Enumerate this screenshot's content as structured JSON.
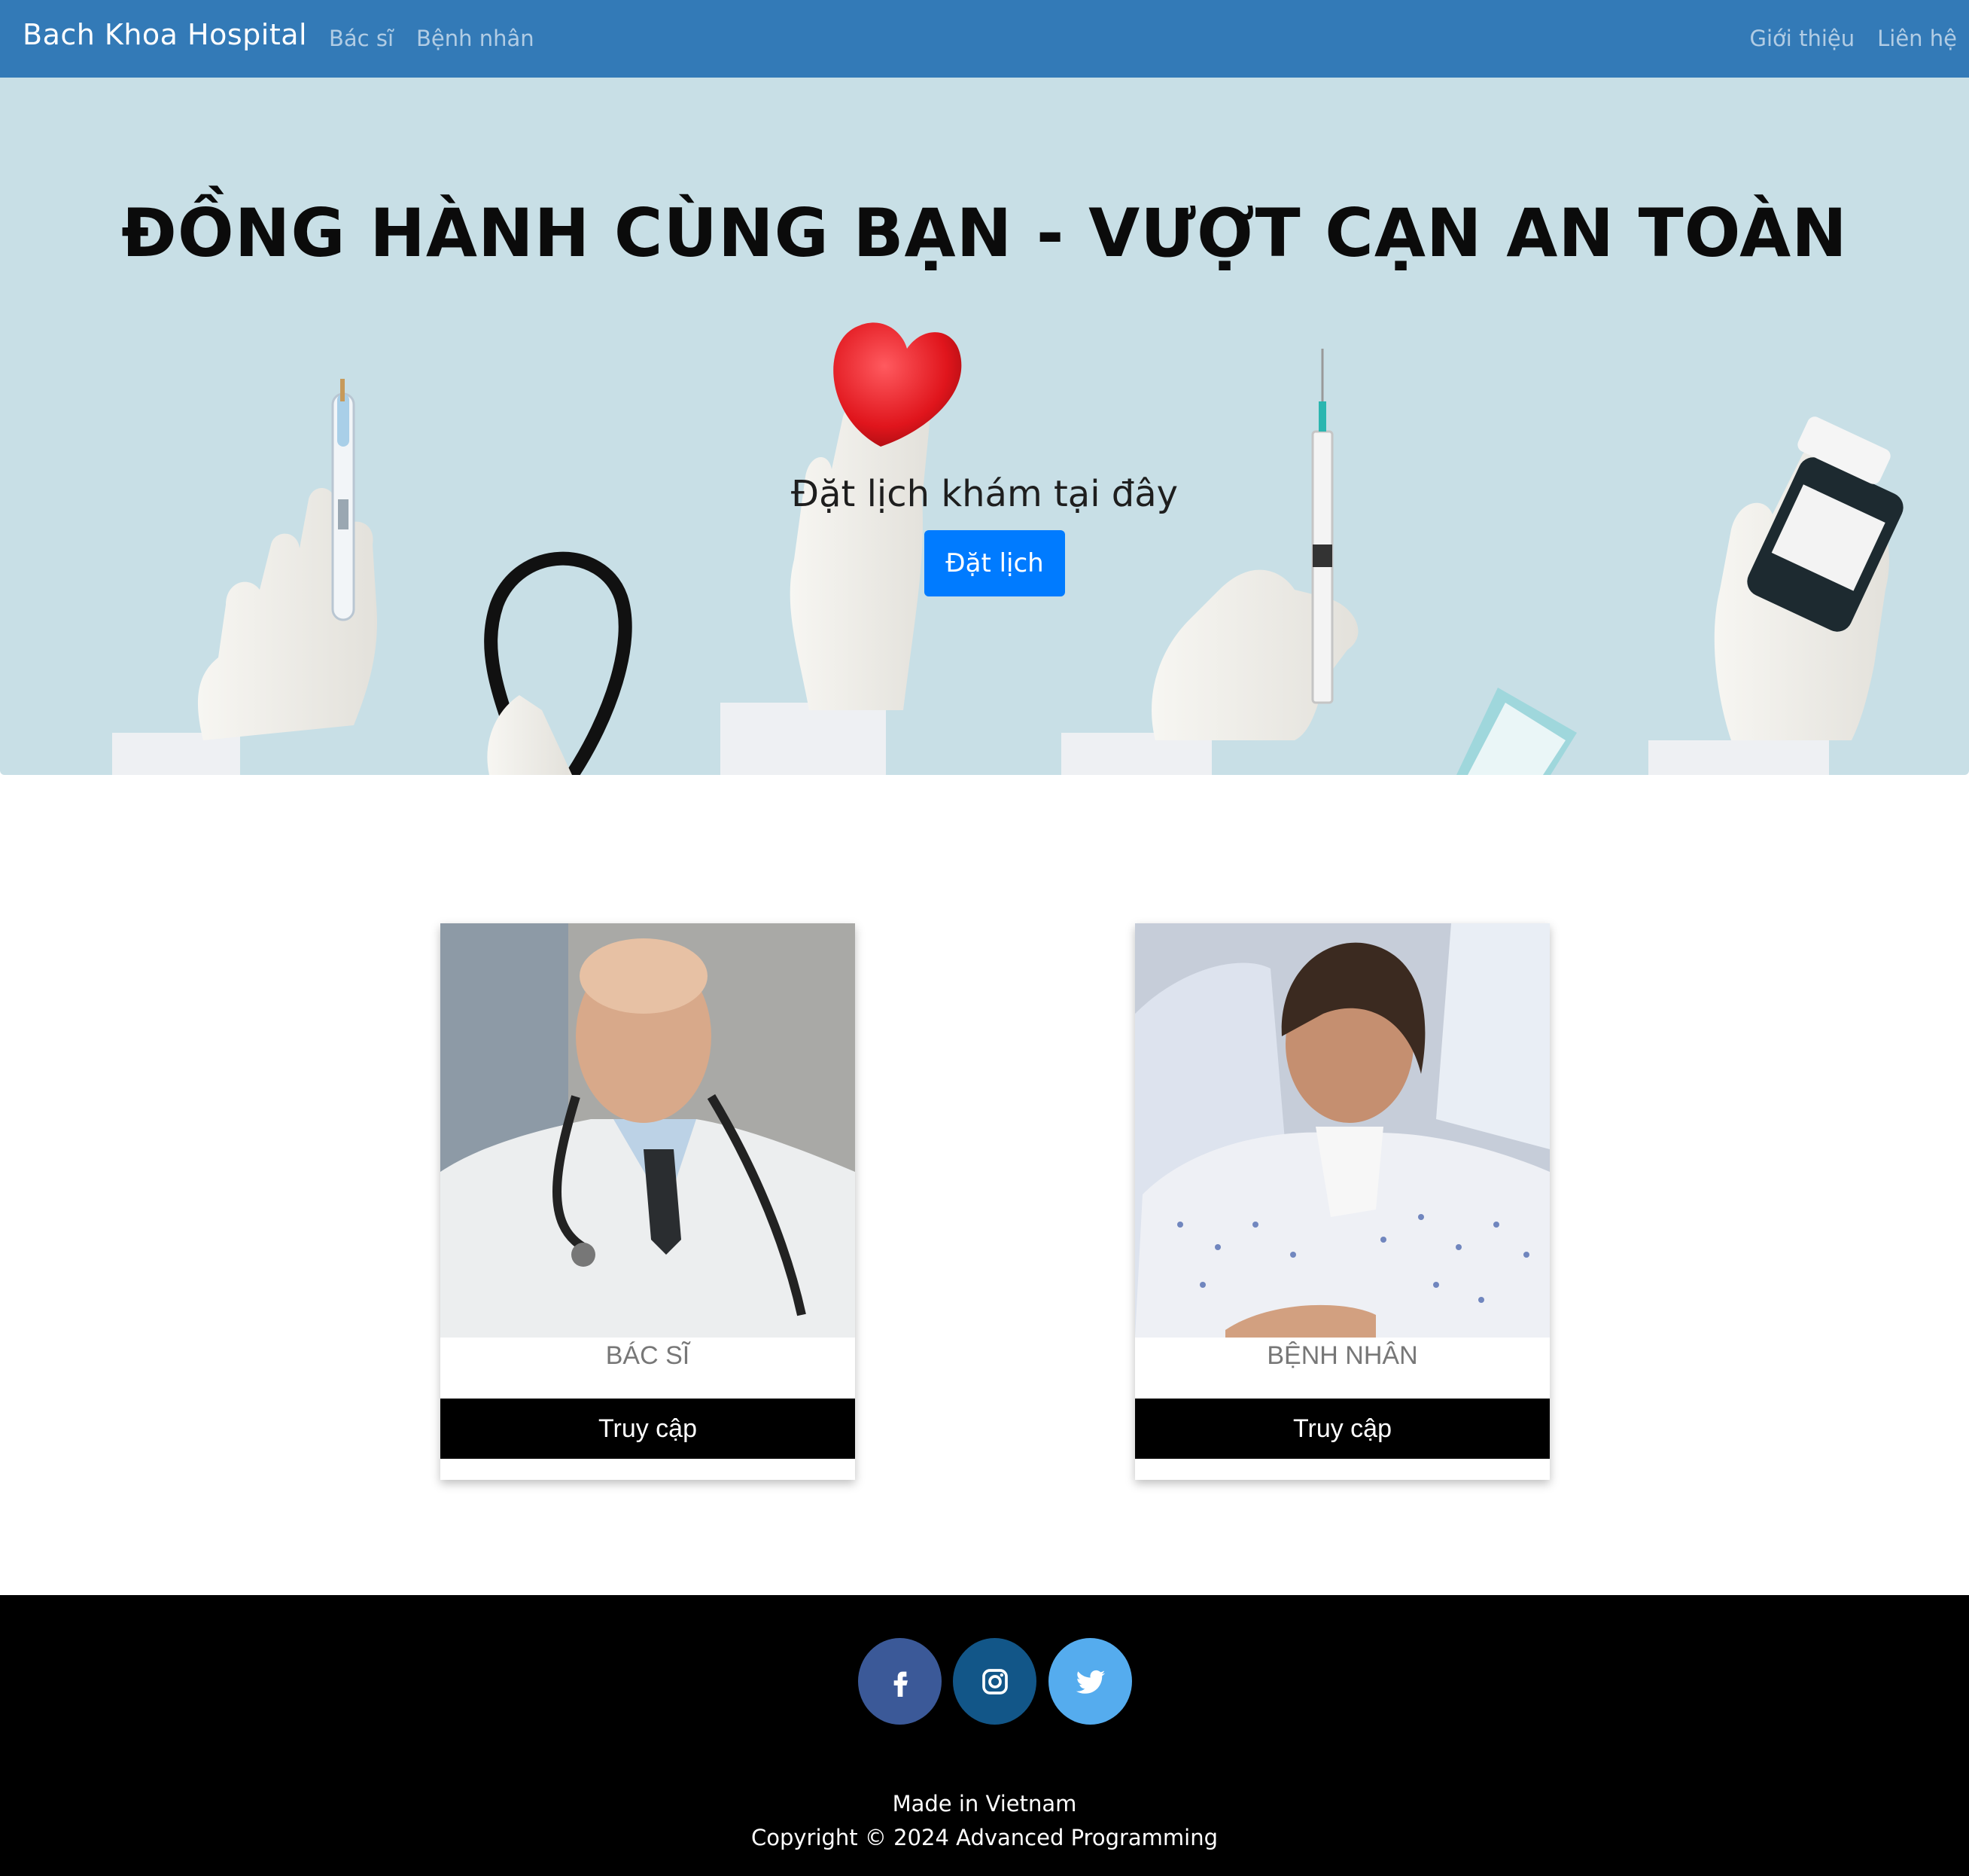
{
  "navbar": {
    "brand": "Bach Khoa Hospital",
    "left_links": [
      "Bác sĩ",
      "Bệnh nhân"
    ],
    "right_links": [
      "Giới thiệu",
      "Liên hệ"
    ],
    "color": "#337ab7"
  },
  "hero": {
    "title": "ĐỒNG HÀNH CÙNG BẠN - VƯỢT CẠN AN TOÀN",
    "subtitle": "Đặt lịch khám tại đây",
    "button_label": "Đặt lịch",
    "button_color": "#007bff",
    "background_color": "#c8dfe6"
  },
  "cards": [
    {
      "title": "BÁC SĨ",
      "button_label": "Truy cập",
      "image": "doctor-photo"
    },
    {
      "title": "BỆNH NHÂN",
      "button_label": "Truy cập",
      "image": "patient-photo"
    }
  ],
  "footer": {
    "social": [
      {
        "icon": "facebook-icon",
        "color": "#3b5998"
      },
      {
        "icon": "instagram-icon",
        "color": "#125688"
      },
      {
        "icon": "twitter-icon",
        "color": "#55acee"
      }
    ],
    "line1": "Made in Vietnam",
    "line2": "Copyright © 2024 Advanced Programming"
  }
}
